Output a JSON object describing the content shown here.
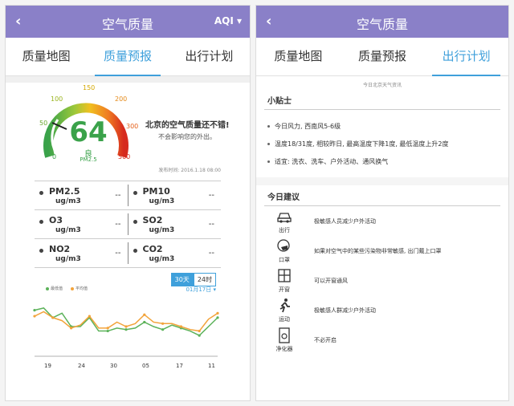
{
  "left": {
    "header": {
      "back": "‹",
      "title": "空气质量",
      "aqi_label": "AQI",
      "aqi_chevron": "▾"
    },
    "tabs": [
      {
        "label": "质量地图"
      },
      {
        "label": "质量预报"
      },
      {
        "label": "出行计划"
      }
    ],
    "gauge": {
      "value": "64",
      "level": "良",
      "pollutant": "PM2.5",
      "ticks": [
        "0",
        "50",
        "100",
        "150",
        "200",
        "300",
        "500"
      ],
      "needle_value": 64
    },
    "message": "北京的空气质量还不错!",
    "message_sub": "不会影响您的外出。",
    "publish_time": "发布时间: 2016.1.18 08:00",
    "pollutants": [
      {
        "name": "PM2.5",
        "unit": "ug/m3",
        "value": "--"
      },
      {
        "name": "PM10",
        "unit": "ug/m3",
        "value": "--"
      },
      {
        "name": "O3",
        "unit": "ug/m3",
        "value": "--"
      },
      {
        "name": "SO2",
        "unit": "ug/m3",
        "value": "--"
      },
      {
        "name": "NO2",
        "unit": "ug/m3",
        "value": "--"
      },
      {
        "name": "CO2",
        "unit": "ug/m3",
        "value": "--"
      }
    ],
    "chart_controls": {
      "btn_30": "30天",
      "btn_24": "24时",
      "date_select": "01月17日 ▾"
    },
    "legend": {
      "green": "最低值",
      "orange": "平均值"
    },
    "colors": {
      "accent": "#3fa0db",
      "header": "#8a80c8",
      "green": "#5cb25a",
      "orange": "#f2a33a"
    }
  },
  "chart_data": {
    "type": "line",
    "x": [
      "19",
      "24",
      "30",
      "05",
      "17",
      "11"
    ],
    "series": [
      {
        "values": [
          62,
          65,
          52,
          58,
          40,
          40,
          52,
          34,
          34,
          38,
          36,
          38,
          46,
          40,
          36,
          42,
          38,
          34,
          28,
          40,
          52
        ]
      },
      {
        "values": [
          54,
          60,
          52,
          48,
          38,
          42,
          54,
          38,
          38,
          46,
          40,
          44,
          56,
          46,
          44,
          44,
          40,
          36,
          34,
          50,
          58
        ]
      }
    ]
  },
  "right": {
    "header": {
      "back": "‹",
      "title": "空气质量"
    },
    "tabs": [
      {
        "label": "质量地图"
      },
      {
        "label": "质量预报"
      },
      {
        "label": "出行计划"
      }
    ],
    "today_note": "今日北京天气资讯",
    "tips_title": "小贴士",
    "tips": [
      "今日风力, 西南风5-6级",
      "温度18/31度, 相较昨日, 最高温度下降1度, 最低温度上升2度",
      "适宜: 洗衣、洗车、户外活动、通风换气"
    ],
    "advice_title": "今日建议",
    "advice": [
      {
        "label": "出行",
        "icon": "car-icon",
        "text": "极敏感人员减少户外活动"
      },
      {
        "label": "口罩",
        "icon": "mask-icon",
        "text": "如果对空气中的某些污染物非常敏感, 出门戴上口罩"
      },
      {
        "label": "开窗",
        "icon": "window-icon",
        "text": "可以开窗通风"
      },
      {
        "label": "运动",
        "icon": "running-icon",
        "text": "极敏感人群减少户外活动"
      },
      {
        "label": "净化器",
        "icon": "purifier-icon",
        "text": "不必开启"
      }
    ]
  }
}
